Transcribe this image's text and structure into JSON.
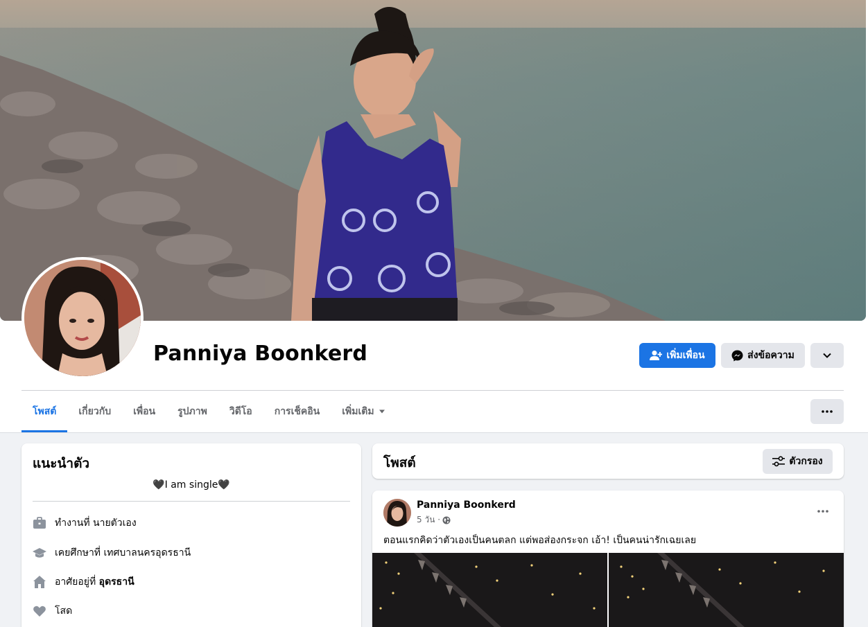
{
  "profile": {
    "name": "Panniya Boonkerd",
    "add_friend_label": "เพิ่มเพื่อน",
    "message_label": "ส่งข้อความ"
  },
  "tabs": [
    {
      "label": "โพสต์",
      "active": true
    },
    {
      "label": "เกี่ยวกับ",
      "active": false
    },
    {
      "label": "เพื่อน",
      "active": false
    },
    {
      "label": "รูปภาพ",
      "active": false
    },
    {
      "label": "วิดีโอ",
      "active": false
    },
    {
      "label": "การเช็คอิน",
      "active": false
    },
    {
      "label": "เพิ่มเติม",
      "active": false
    }
  ],
  "intro": {
    "title": "แนะนำตัว",
    "bio": "🖤I am single🖤",
    "work": "ทำงานที่ นายตัวเอง",
    "education": "เคยศึกษาที่ เทศบาลนครอุดรธานี",
    "lives_prefix": "อาศัยอยู่ที่ ",
    "lives_place": "อุดรธานี",
    "relationship": "โสด"
  },
  "posts_header": {
    "title": "โพสต์",
    "filter_label": "ตัวกรอง"
  },
  "post": {
    "author": "Panniya Boonkerd",
    "time": "5 วัน ·",
    "text": "ตอนแรกคิดว่าตัวเองเป็นคนตลก แต่พอส่องกระจก เอ้า! เป็นคนน่ารักเฉยเลย"
  },
  "colors": {
    "accent": "#1b74e4",
    "background": "#f0f2f5",
    "secondary_text": "#65676b"
  }
}
